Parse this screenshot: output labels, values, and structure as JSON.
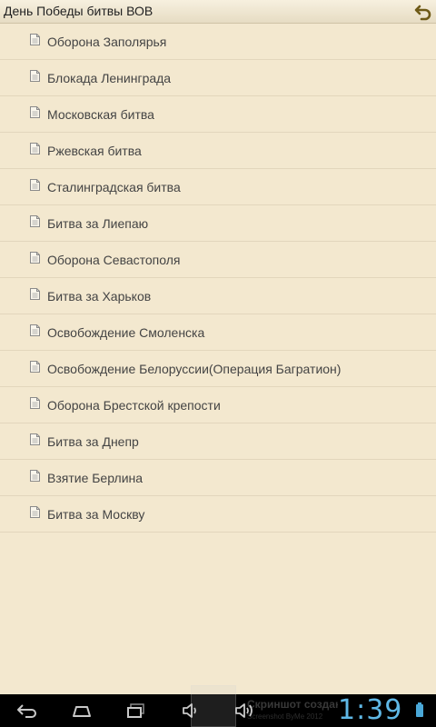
{
  "header": {
    "title": "День Победы битвы ВОВ",
    "back_icon": "back-arrow-icon"
  },
  "items": [
    {
      "label": "Оборона Заполярья"
    },
    {
      "label": "Блокада Ленинграда"
    },
    {
      "label": "Московская битва"
    },
    {
      "label": "Ржевская битва"
    },
    {
      "label": "Сталинградская битва"
    },
    {
      "label": "Битва за Лиепаю"
    },
    {
      "label": "Оборона Севастополя"
    },
    {
      "label": "Битва за Харьков"
    },
    {
      "label": "Освобождение Смоленска"
    },
    {
      "label": "Освобождение Белоруссии(Операция Багратион)"
    },
    {
      "label": "Оборона Брестской крепости"
    },
    {
      "label": "Битва за Днепр"
    },
    {
      "label": "Взятие Берлина"
    },
    {
      "label": "Битва за Москву"
    }
  ],
  "item_icon": "document-icon",
  "statusbar": {
    "watermark_title": "Скриншот создан",
    "watermark_sub": "Screenshot ByMe 2012",
    "clock": "1:39"
  },
  "colors": {
    "background": "#f3e8cf",
    "clock": "#5fb8e6"
  }
}
